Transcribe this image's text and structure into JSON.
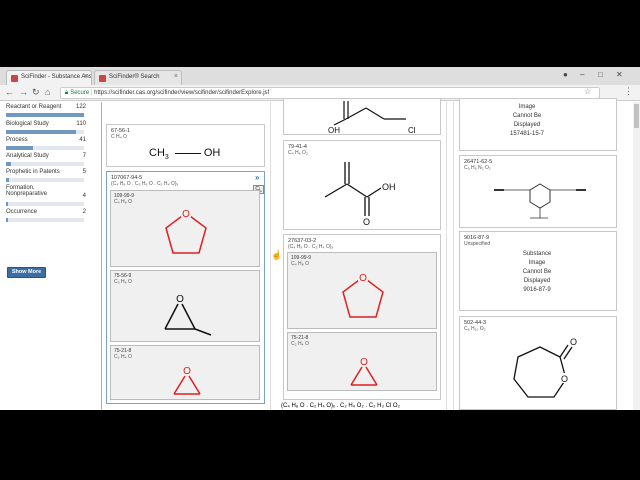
{
  "browser": {
    "tabs": [
      {
        "label": "SciFinder - Substance Ans"
      },
      {
        "label": "SciFinder® Search"
      }
    ],
    "url": "https://scifinder.cas.org/scifinder/view/scifinder/scifinderExplore.jsf",
    "secure_label": "Secure"
  },
  "facets": [
    {
      "label": "Reactant or Reagent",
      "count": "122",
      "fraction": 1.0
    },
    {
      "label": "Biological Study",
      "count": "110",
      "fraction": 0.9
    },
    {
      "label": "Process",
      "count": "41",
      "fraction": 0.34
    },
    {
      "label": "Analytical Study",
      "count": "7",
      "fraction": 0.06
    },
    {
      "label": "Prophetic in Patents",
      "count": "5",
      "fraction": 0.04
    },
    {
      "label": "Formation,",
      "label2": "Nonpreparative",
      "count": "4",
      "fraction": 0.03
    },
    {
      "label": "Occurrence",
      "count": "2",
      "fraction": 0.02
    }
  ],
  "show_more": "Show More",
  "col1": {
    "card1": {
      "rn": "67-56-1",
      "mf": "C H₄ O",
      "formula_left": "CH",
      "formula_sub": "3",
      "formula_right": "OH"
    },
    "card2": {
      "rn": "107067-94-5",
      "mf": "(C₄ H₈ O . C₃ H₆ O . C₂ H₄ O)ₓ",
      "subs": [
        {
          "rn": "109-99-9",
          "mf": "C₄ H₈ O"
        },
        {
          "rn": "75-56-9",
          "mf": "C₃ H₆ O"
        },
        {
          "rn": "75-21-8",
          "mf": "C₂ H₄ O"
        }
      ]
    }
  },
  "col2": {
    "card1": {
      "oh": "OH",
      "cl": "Cl"
    },
    "card2": {
      "rn": "79-41-4",
      "mf": "C₄ H₆ O₂",
      "oh": "OH",
      "o": "O"
    },
    "card3": {
      "rn": "27637-03-2",
      "mf": "(C₄ H₈ O . C₂ H₄ O)ₓ",
      "subs": [
        {
          "rn": "109-99-9",
          "mf": "C₄ H₈ O"
        },
        {
          "rn": "75-21-8",
          "mf": "C₂ H₄ O"
        }
      ]
    },
    "bottom_text": "(C₄ H₈ O . C₂ H₄ O)ₓ . C₂ H₄ O₂ . C₂ H₃ Cl O₂"
  },
  "col3": {
    "card1": {
      "line1": "Image",
      "line2": "Cannot Be",
      "line3": "Displayed",
      "line4": "157481-15-7"
    },
    "card2": {
      "rn": "26471-62-5",
      "mf": "C₉ H₆ N₂ O₂"
    },
    "card3": {
      "rn": "9016-87-9",
      "mf": "Unspecified",
      "line1": "Substance",
      "line2": "Image",
      "line3": "Cannot Be",
      "line4": "Displayed",
      "line5": "9016-87-9"
    },
    "card4": {
      "rn": "502-44-3",
      "mf": "C₆ H₁₀ O₂",
      "o1": "O",
      "o2": "O"
    }
  },
  "colors": {
    "accent": "#3a6ea5",
    "structure_red": "#e02020",
    "structure_black": "#111111"
  }
}
